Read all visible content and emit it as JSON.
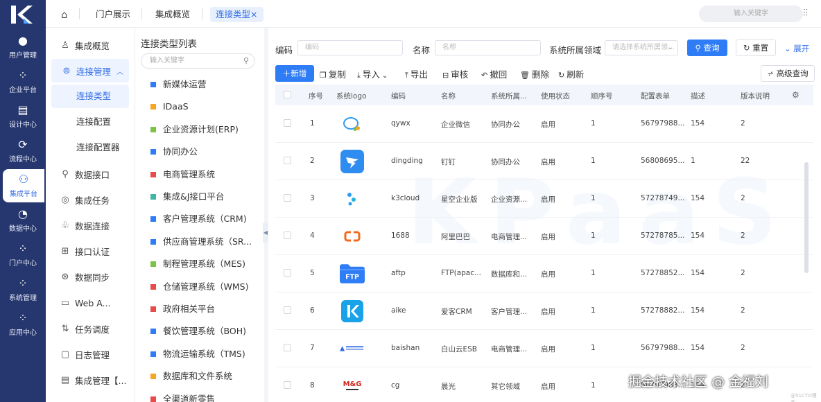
{
  "rail": {
    "items": [
      {
        "label": "用户管理",
        "icon": "user-icon"
      },
      {
        "label": "企业平台",
        "icon": "grid-icon"
      },
      {
        "label": "设计中心",
        "icon": "design-icon"
      },
      {
        "label": "流程中心",
        "icon": "flow-icon"
      },
      {
        "label": "集成平台",
        "icon": "integration-icon"
      },
      {
        "label": "数据中心",
        "icon": "pie-icon"
      },
      {
        "label": "门户中心",
        "icon": "grid-icon"
      },
      {
        "label": "系统管理",
        "icon": "grid-icon"
      },
      {
        "label": "应用中心",
        "icon": "grid-icon"
      }
    ],
    "active_index": 4
  },
  "tabs": [
    "门户展示",
    "集成概览",
    "连接类型"
  ],
  "tab_close": "×",
  "top_search_placeholder": "输入关键字",
  "menu": {
    "items": [
      "集成概览",
      "连接管理",
      "连接类型",
      "连接配置",
      "连接配置器",
      "数据接口",
      "集成任务",
      "数据连接",
      "接口认证",
      "数据同步",
      "Web A...",
      "任务调度",
      "日志管理",
      "集成管理【..."
    ]
  },
  "typelist": {
    "title": "连接类型列表",
    "search_placeholder": "输入关键字",
    "items": [
      "新媒体运营",
      "IDaaS",
      "企业资源计划(ERP)",
      "协同办公",
      "电商管理系统",
      "集成&J接口平台",
      "客户管理系统（CRM)",
      "供应商管理系统（SR...",
      "制程管理系统（MES)",
      "仓储管理系统（WMS)",
      "政府相关平台",
      "餐饮管理系统（BOH)",
      "物流运输系统（TMS)",
      "数据库和文件系统",
      "全渠道新零售"
    ],
    "colors": [
      "#2f7df6",
      "#f5a623",
      "#7cc245",
      "#2f7df6",
      "#e94b4b",
      "#3fb6a8",
      "#2f7df6",
      "#2f7df6",
      "#7cc245",
      "#e94b4b",
      "#e94b4b",
      "#2f7df6",
      "#2f7df6",
      "#f5a623",
      "#e94b4b"
    ]
  },
  "filters": {
    "code_label": "编码",
    "code_placeholder": "编码",
    "name_label": "名称",
    "name_placeholder": "名称",
    "domain_label": "系统所属领域",
    "domain_placeholder": "请选择系统所属领...",
    "query_btn": "查询",
    "reset_btn": "重置",
    "expand_link": "展开"
  },
  "toolbar": {
    "add": "新增",
    "copy": "复制",
    "import": "导入",
    "export": "导出",
    "audit": "审核",
    "revoke": "撤回",
    "delete": "删除",
    "refresh": "刷新",
    "advanced": "高级查询"
  },
  "table": {
    "columns": [
      "序号",
      "系统logo",
      "编码",
      "名称",
      "系统所属...",
      "使用状态",
      "顺序号",
      "配置表单",
      "描述",
      "版本说明"
    ],
    "rows": [
      {
        "no": "1",
        "logo": "wecom-logo",
        "code": "qywx",
        "name": "企业微信",
        "domain": "协同办公",
        "status": "启用",
        "order": "1",
        "form": "56797988...",
        "desc": "154",
        "version": "2"
      },
      {
        "no": "2",
        "logo": "dingtalk-logo",
        "code": "dingding",
        "name": "钉钉",
        "domain": "协同办公",
        "status": "启用",
        "order": "1",
        "form": "56808695...",
        "desc": "1",
        "version": "22"
      },
      {
        "no": "3",
        "logo": "k3cloud-logo",
        "code": "k3cloud",
        "name": "星空企业版",
        "domain": "企业资源...",
        "status": "启用",
        "order": "1",
        "form": "57278749...",
        "desc": "154",
        "version": "2"
      },
      {
        "no": "4",
        "logo": "1688-logo",
        "code": "1688",
        "name": "阿里巴巴",
        "domain": "电商管理...",
        "status": "启用",
        "order": "1",
        "form": "57278785...",
        "desc": "154",
        "version": "2"
      },
      {
        "no": "5",
        "logo": "ftp-logo",
        "code": "aftp",
        "name": "FTP(apac...",
        "domain": "数据库和...",
        "status": "启用",
        "order": "1",
        "form": "57278852...",
        "desc": "154",
        "version": "2"
      },
      {
        "no": "6",
        "logo": "aike-logo",
        "code": "aike",
        "name": "爱客CRM",
        "domain": "客户管理...",
        "status": "启用",
        "order": "1",
        "form": "57278882...",
        "desc": "154",
        "version": "2"
      },
      {
        "no": "7",
        "logo": "baishan-logo",
        "code": "baishan",
        "name": "白山云ESB",
        "domain": "电商管理...",
        "status": "启用",
        "order": "1",
        "form": "56797988...",
        "desc": "154",
        "version": "2"
      },
      {
        "no": "8",
        "logo": "mg-logo",
        "code": "cg",
        "name": "晨光",
        "domain": "其它领域",
        "status": "启用",
        "order": "1",
        "form": "56797988...",
        "desc": "154",
        "version": "2"
      }
    ]
  },
  "ftp_logo_text": "FTP",
  "mg_logo_text": "M&G",
  "watermark": "KPaaS",
  "credit": "掘金技术社区 @ 金福刘",
  "credit_small": "@51CTO博客"
}
